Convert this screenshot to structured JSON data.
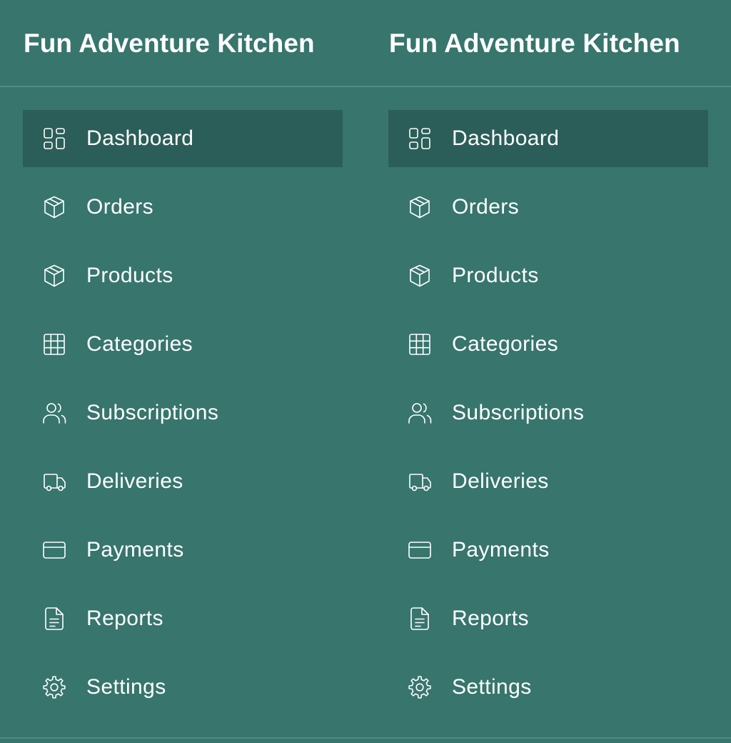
{
  "panels": [
    {
      "title": "Fun Adventure Kitchen",
      "nav": [
        {
          "label": "Dashboard",
          "icon": "dashboard-icon",
          "active": true
        },
        {
          "label": "Orders",
          "icon": "package-icon",
          "active": false
        },
        {
          "label": "Products",
          "icon": "package-icon",
          "active": false
        },
        {
          "label": "Categories",
          "icon": "grid-icon",
          "active": false
        },
        {
          "label": "Subscriptions",
          "icon": "users-icon",
          "active": false
        },
        {
          "label": "Deliveries",
          "icon": "truck-icon",
          "active": false
        },
        {
          "label": "Payments",
          "icon": "credit-card-icon",
          "active": false
        },
        {
          "label": "Reports",
          "icon": "document-icon",
          "active": false
        },
        {
          "label": "Settings",
          "icon": "gear-icon",
          "active": false
        }
      ]
    },
    {
      "title": "Fun Adventure Kitchen",
      "nav": [
        {
          "label": "Dashboard",
          "icon": "dashboard-icon",
          "active": true
        },
        {
          "label": "Orders",
          "icon": "package-icon",
          "active": false
        },
        {
          "label": "Products",
          "icon": "package-icon",
          "active": false
        },
        {
          "label": "Categories",
          "icon": "grid-icon",
          "active": false
        },
        {
          "label": "Subscriptions",
          "icon": "users-icon",
          "active": false
        },
        {
          "label": "Deliveries",
          "icon": "truck-icon",
          "active": false
        },
        {
          "label": "Payments",
          "icon": "credit-card-icon",
          "active": false
        },
        {
          "label": "Reports",
          "icon": "document-icon",
          "active": false
        },
        {
          "label": "Settings",
          "icon": "gear-icon",
          "active": false
        }
      ]
    }
  ],
  "colors": {
    "background": "#37756d",
    "active_item": "#2b5e58",
    "divider": "#4f8c84",
    "text": "#ffffff"
  }
}
